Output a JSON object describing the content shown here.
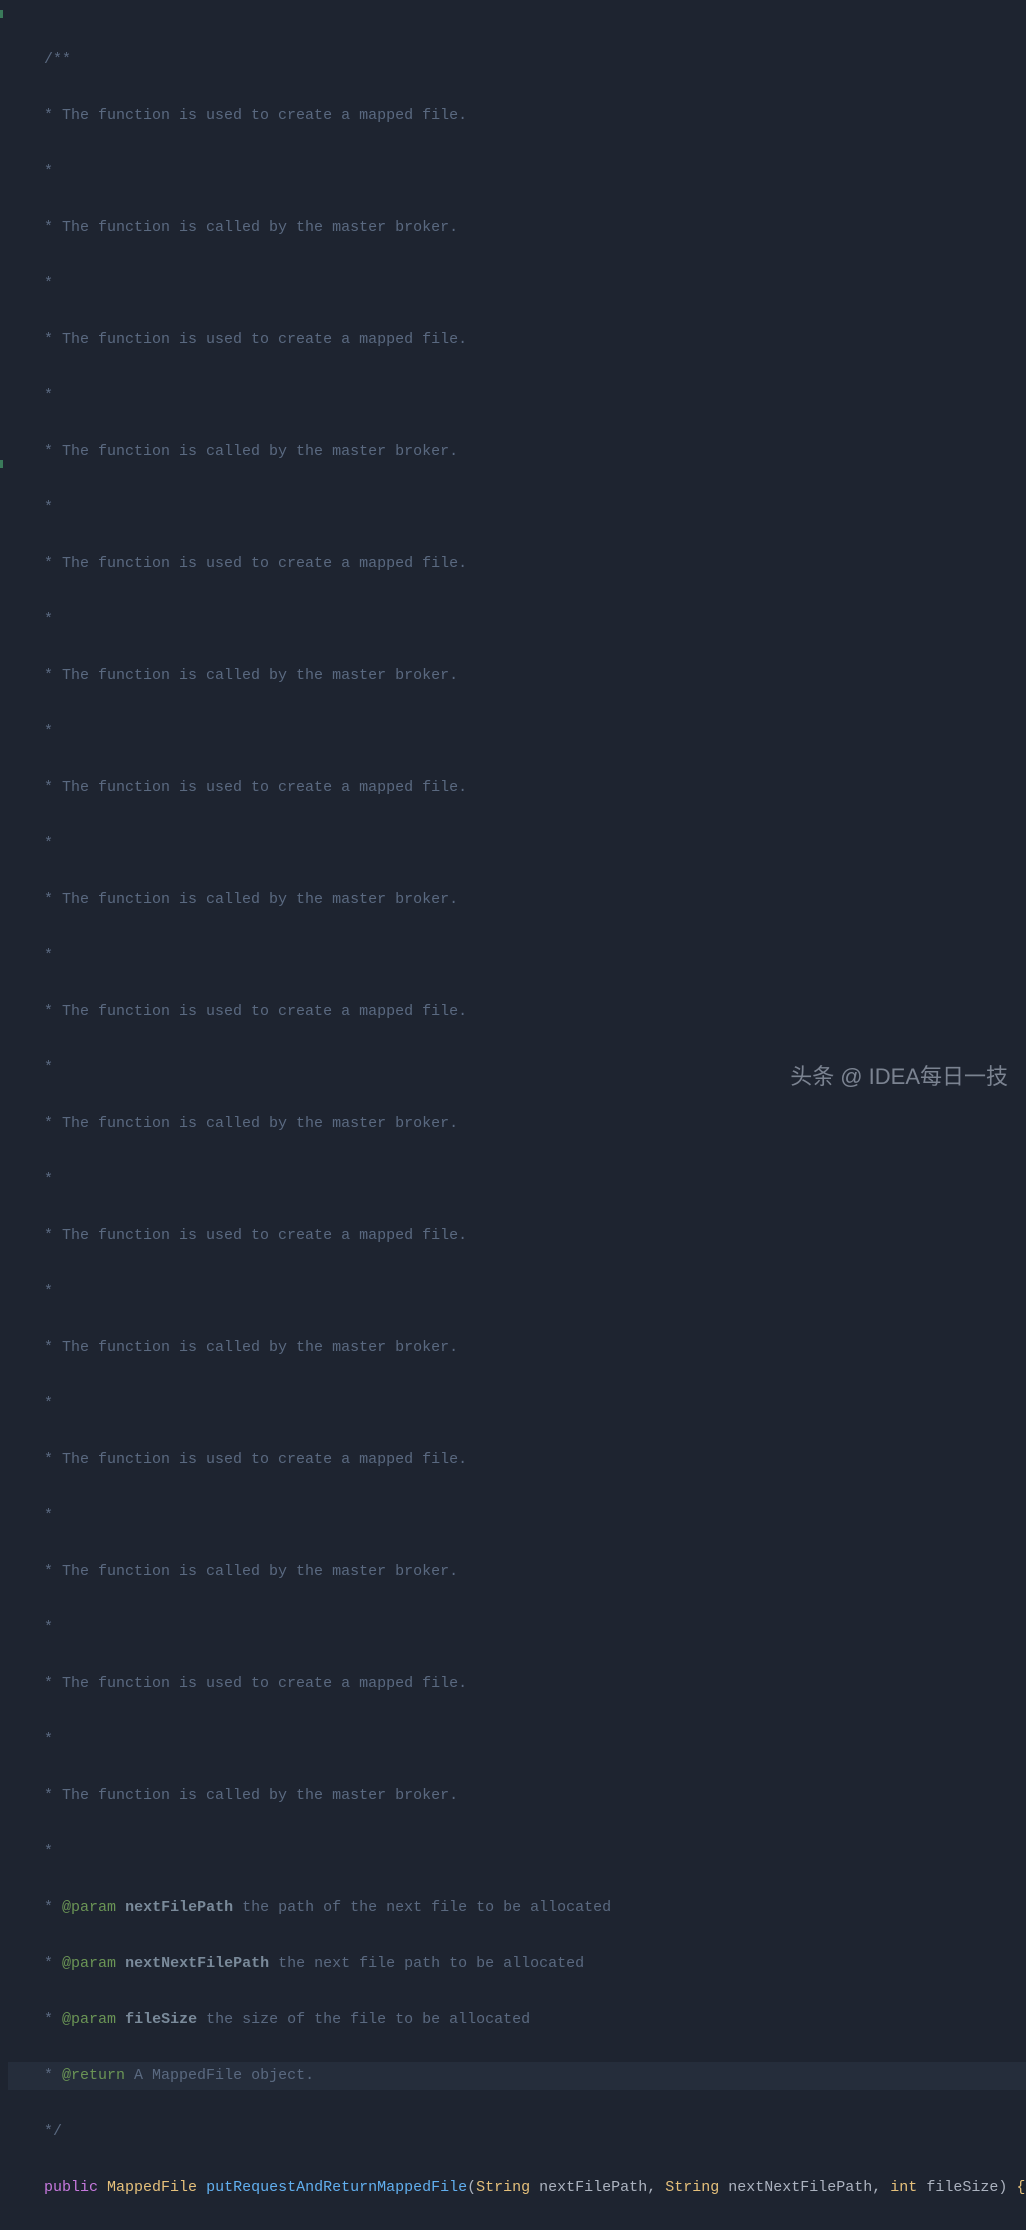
{
  "comment": {
    "open": "/**",
    "body": [
      " * The function is used to create a mapped file.",
      " *",
      " * The function is called by the master broker.",
      " *",
      " * The function is used to create a mapped file.",
      " *",
      " * The function is called by the master broker.",
      " *",
      " * The function is used to create a mapped file.",
      " *",
      " * The function is called by the master broker.",
      " *",
      " * The function is used to create a mapped file.",
      " *",
      " * The function is called by the master broker.",
      " *",
      " * The function is used to create a mapped file.",
      " *",
      " * The function is called by the master broker.",
      " *",
      " * The function is used to create a mapped file.",
      " *",
      " * The function is called by the master broker.",
      " *",
      " * The function is used to create a mapped file.",
      " *",
      " * The function is called by the master broker.",
      " *",
      " * The function is used to create a mapped file.",
      " *",
      " * The function is called by the master broker.",
      " *"
    ],
    "param_prefix": " * ",
    "params": [
      {
        "tag": "@param",
        "name": "nextFilePath",
        "desc": " the path of the next file to be allocated"
      },
      {
        "tag": "@param",
        "name": "nextNextFilePath",
        "desc": " the next file path to be allocated"
      },
      {
        "tag": "@param",
        "name": "fileSize",
        "desc": " the size of the file to be allocated"
      }
    ],
    "return": {
      "tag": "@return",
      "desc": " A MappedFile object."
    },
    "close": " */"
  },
  "signature": {
    "indent": "    ",
    "modifier": "public",
    "return_type": "MappedFile",
    "method": "putRequestAndReturnMappedFile",
    "params": [
      {
        "type": "String",
        "name": "nextFilePath"
      },
      {
        "type": "String",
        "name": "nextNextFilePath"
      },
      {
        "type": "int",
        "name": "fileSize"
      }
    ],
    "fold": "{...}",
    "paren_open": "(",
    "paren_close": ")",
    "comma": ", ",
    "space": " "
  },
  "watermark": {
    "prefix": "头条",
    "at": "@",
    "name": "IDEA每日一技"
  }
}
